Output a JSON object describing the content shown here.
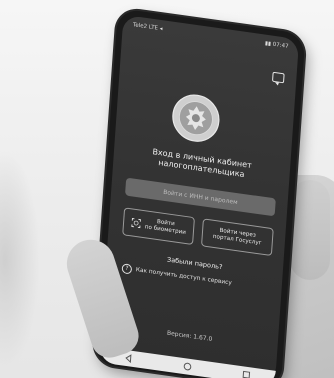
{
  "status_bar": {
    "left": "Tele2 LTE ◂",
    "right": "▮▮ 07:47"
  },
  "screen": {
    "title_line1": "Вход в личный кабинет",
    "title_line2": "налогоплательщика",
    "login_button": "Войти с ИНН и паролем",
    "biometrics_button_line1": "Войти",
    "biometrics_button_line2": "по биометрии",
    "gosuslugi_button_line1": "Войти через",
    "gosuslugi_button_line2": "портал Госуслуг",
    "forgot_password": "Забыли пароль?",
    "access_help": "Как получить доступ к сервису",
    "version": "Версия: 1.67.0"
  },
  "colors": {
    "screen_bg": "#333333",
    "primary_button_bg": "#6a6a6a",
    "text": "#f0f0f0"
  },
  "icons": [
    "chat-icon",
    "fns-emblem",
    "face-id-icon",
    "gosuslugi-icon",
    "question-icon",
    "back-icon",
    "home-icon",
    "recents-icon"
  ]
}
